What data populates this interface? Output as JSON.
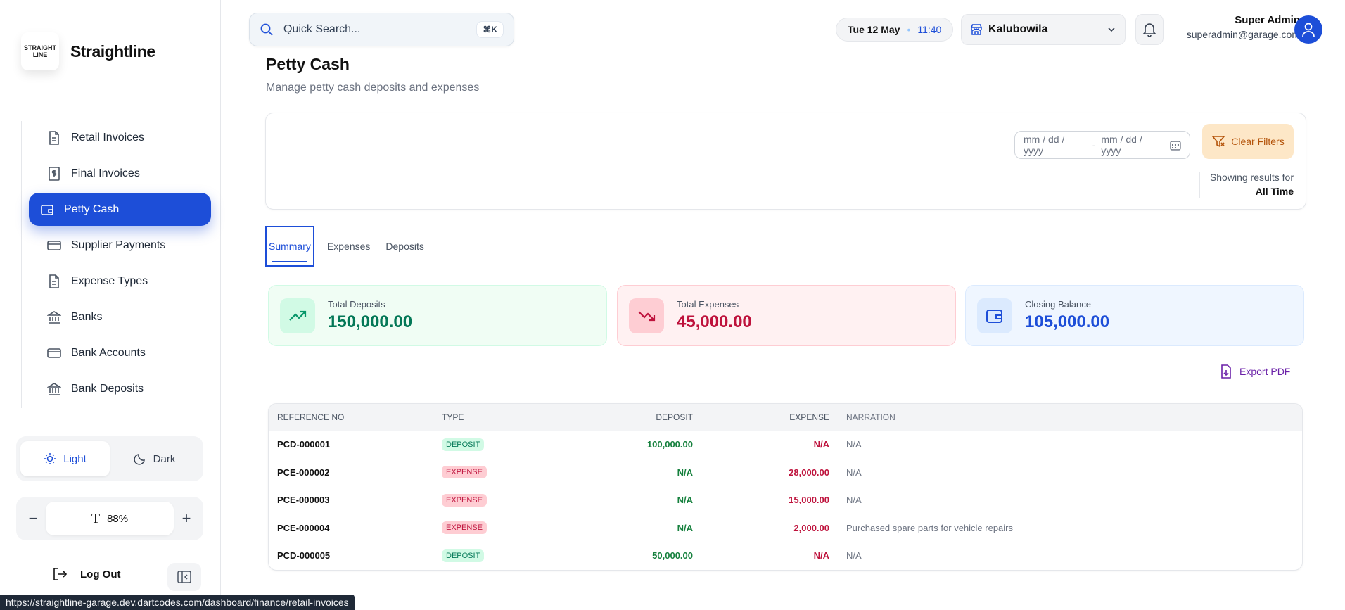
{
  "brand": {
    "logo_line1": "STRAIGHT",
    "logo_line2": "LINE",
    "name": "Straightline"
  },
  "sidebar": {
    "items": [
      {
        "label": "Retail Invoices"
      },
      {
        "label": "Final Invoices"
      },
      {
        "label": "Petty Cash"
      },
      {
        "label": "Supplier Payments"
      },
      {
        "label": "Expense Types"
      },
      {
        "label": "Banks"
      },
      {
        "label": "Bank Accounts"
      },
      {
        "label": "Bank Deposits"
      }
    ],
    "active_index": 2,
    "theme": {
      "light": "Light",
      "dark": "Dark",
      "selected": "Light"
    },
    "zoom": {
      "value": "88%",
      "minus": "−",
      "plus": "+"
    },
    "logout": "Log Out"
  },
  "status_url": "https://straightline-garage.dev.dartcodes.com/dashboard/finance/retail-invoices",
  "topbar": {
    "search_placeholder": "Quick Search...",
    "shortcut": "⌘K",
    "date": "Tue 12 May",
    "time": "11:40",
    "branch": "Kalubowila",
    "user_name": "Super Admin",
    "user_email": "superadmin@garage.com"
  },
  "page": {
    "title": "Petty Cash",
    "subtitle": "Manage petty cash deposits and expenses"
  },
  "filters": {
    "date_from_placeholder": "mm / dd / yyyy",
    "date_sep": "-",
    "date_to_placeholder": "mm / dd / yyyy",
    "clear_label": "Clear Filters",
    "showing_label": "Showing results for",
    "showing_value": "All Time"
  },
  "tabs": [
    {
      "label": "Summary"
    },
    {
      "label": "Expenses"
    },
    {
      "label": "Deposits"
    }
  ],
  "stats": {
    "deposits": {
      "label": "Total Deposits",
      "value": "150,000.00"
    },
    "expenses": {
      "label": "Total Expenses",
      "value": "45,000.00"
    },
    "balance": {
      "label": "Closing Balance",
      "value": "105,000.00"
    }
  },
  "export_label": "Export PDF",
  "table": {
    "headers": [
      "REFERENCE NO",
      "TYPE",
      "DEPOSIT",
      "EXPENSE",
      "NARRATION"
    ],
    "rows": [
      {
        "ref": "PCD-000001",
        "type": "DEPOSIT",
        "deposit": "100,000.00",
        "expense": "N/A",
        "narration": "N/A"
      },
      {
        "ref": "PCE-000002",
        "type": "EXPENSE",
        "deposit": "N/A",
        "expense": "28,000.00",
        "narration": "N/A"
      },
      {
        "ref": "PCE-000003",
        "type": "EXPENSE",
        "deposit": "N/A",
        "expense": "15,000.00",
        "narration": "N/A"
      },
      {
        "ref": "PCE-000004",
        "type": "EXPENSE",
        "deposit": "N/A",
        "expense": "2,000.00",
        "narration": "Purchased spare parts for vehicle repairs"
      },
      {
        "ref": "PCD-000005",
        "type": "DEPOSIT",
        "deposit": "50,000.00",
        "expense": "N/A",
        "narration": "N/A"
      }
    ]
  },
  "colors": {
    "accent": "#1d4ed8",
    "deposit": "#047857",
    "expense": "#be123c"
  }
}
